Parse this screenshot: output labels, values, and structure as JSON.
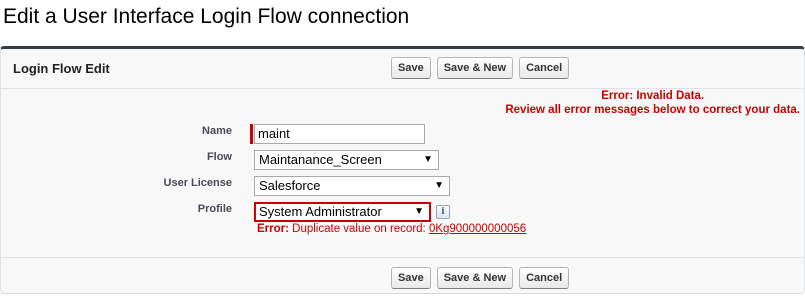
{
  "page": {
    "title": "Edit a User Interface Login Flow connection"
  },
  "panel": {
    "title": "Login Flow Edit",
    "buttons": {
      "save": "Save",
      "save_new": "Save & New",
      "cancel": "Cancel"
    },
    "error": {
      "line1": "Error: Invalid Data.",
      "line2": "Review all error messages below to correct your data."
    }
  },
  "form": {
    "name": {
      "label": "Name",
      "value": "maint"
    },
    "flow": {
      "label": "Flow",
      "value": "Maintanance_Screen"
    },
    "user_license": {
      "label": "User License",
      "value": "Salesforce"
    },
    "profile": {
      "label": "Profile",
      "value": "System Administrator",
      "info_icon": "info-icon",
      "info_glyph": "i"
    },
    "profile_error": {
      "prefix": "Error:",
      "message": " Duplicate value on record: ",
      "link": "0Kg900000000056"
    }
  },
  "colors": {
    "error": "#cc0000",
    "panel_border": "#333f48",
    "panel_bg": "#f8f8f8"
  }
}
